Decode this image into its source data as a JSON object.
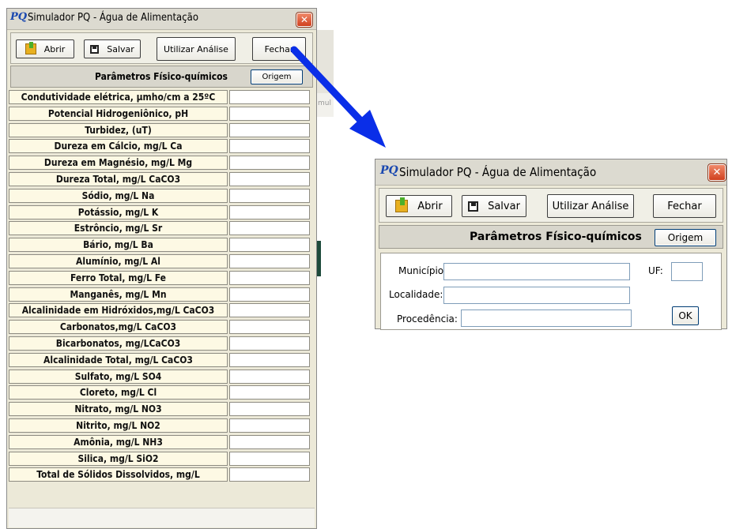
{
  "window_title": "Simulador PQ - Água de Alimentação",
  "app_icon_text": "PQ",
  "toolbar": {
    "open_label": "Abrir",
    "save_label": "Salvar",
    "use_analysis_label": "Utilizar Análise",
    "close_label": "Fechar"
  },
  "section_title": "Parâmetros Físico-químicos",
  "origem_label": "Origem",
  "parameters": [
    "Condutividade elétrica, µmho/cm a 25ºC",
    "Potencial Hidrogeniônico, pH",
    "Turbidez, (uT)",
    "Dureza em Cálcio, mg/L Ca",
    "Dureza em Magnésio, mg/L Mg",
    "Dureza Total, mg/L CaCO3",
    "Sódio, mg/L Na",
    "Potássio, mg/L K",
    "Estrôncio, mg/L Sr",
    "Bário, mg/L Ba",
    "Alumínio, mg/L Al",
    "Ferro Total, mg/L Fe",
    "Manganês, mg/L Mn",
    "Alcalinidade em Hidróxidos,mg/L CaCO3",
    "Carbonatos,mg/L CaCO3",
    "Bicarbonatos, mg/LCaCO3",
    "Alcalinidade Total, mg/L CaCO3",
    "Sulfato, mg/L SO4",
    "Cloreto, mg/L Cl",
    "Nitrato, mg/L NO3",
    "Nitrito, mg/L NO2",
    "Amônia, mg/L NH3",
    "Silica, mg/L SiO2",
    "Total de Sólidos Dissolvidos, mg/L"
  ],
  "origin_form": {
    "municipio_label": "Município:",
    "uf_label": "UF:",
    "localidade_label": "Localidade:",
    "procedencia_label": "Procedência:",
    "ok_label": "OK"
  },
  "background_fragment_text": "mul",
  "colors": {
    "arrow": "#0a2ee8",
    "window_bg": "#ece9d8",
    "label_bg": "#fdf9e4",
    "close_button": "#d8502c"
  }
}
